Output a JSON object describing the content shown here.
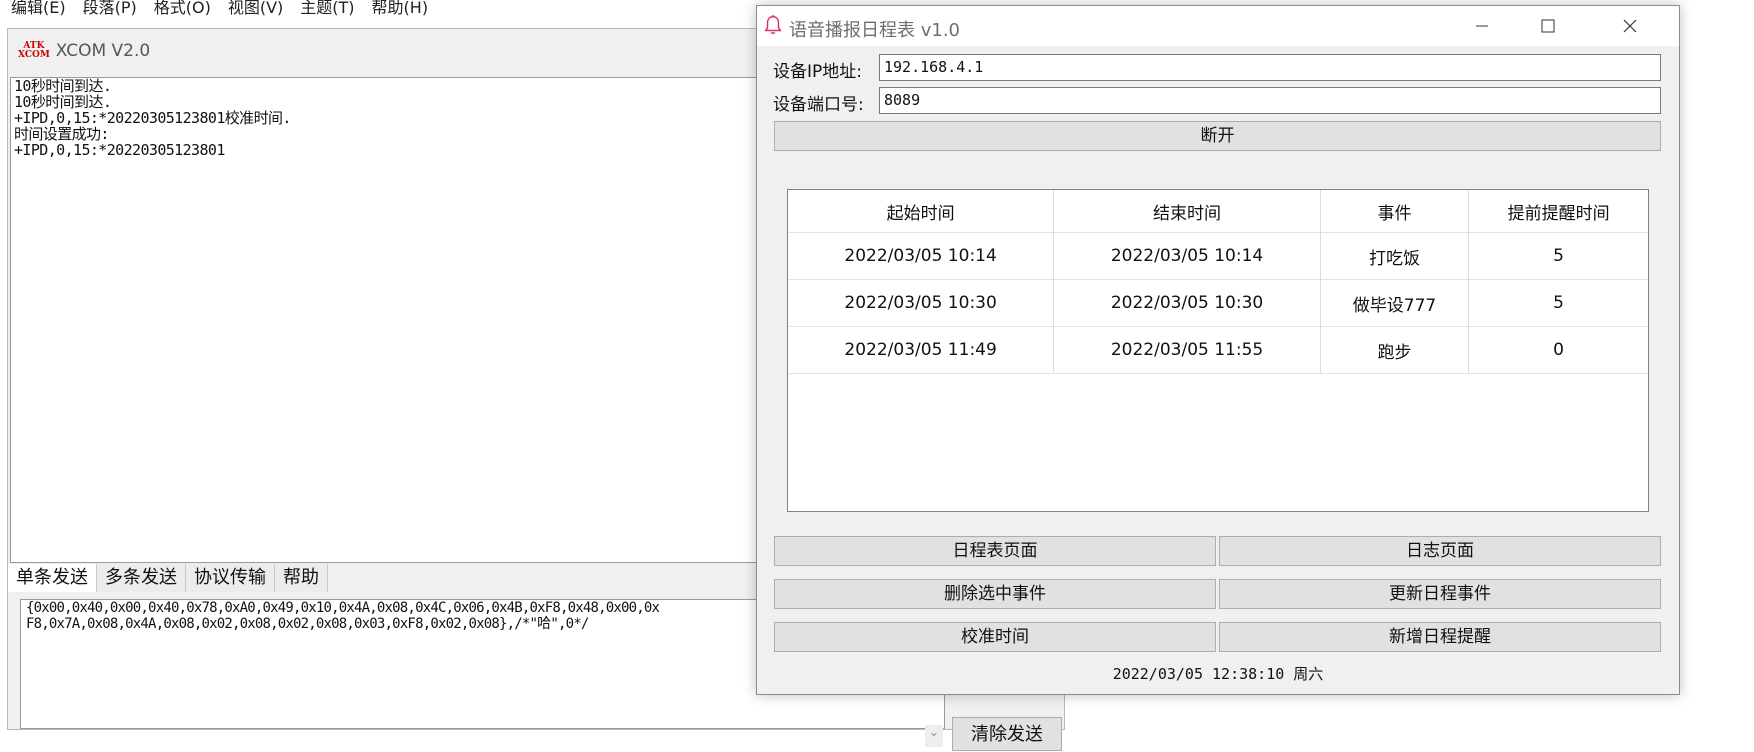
{
  "background_app": {
    "menu": [
      "编辑(E)",
      "段落(P)",
      "格式(O)",
      "视图(V)",
      "主题(T)",
      "帮助(H)"
    ]
  },
  "xcom": {
    "title": "XCOM V2.0",
    "logo_text": "ATK XCOM",
    "receive_lines": [
      "10秒时间到达.",
      "10秒时间到达.",
      "",
      "+IPD,0,15:*20220305123801校准时间.",
      "时间设置成功:",
      "+IPD,0,15:*20220305123801"
    ],
    "tabs": [
      "单条发送",
      "多条发送",
      "协议传输",
      "帮助"
    ],
    "send_lines": [
      "{0x00,0x40,0x00,0x40,0x78,0xA0,0x49,0x10,0x4A,0x08,0x4C,0x06,0x4B,0xF8,0x48,0x00,0x",
      "F8,0x7A,0x08,0x4A,0x08,0x02,0x08,0x02,0x08,0x03,0xF8,0x02,0x08},/*\"哈\",0*/"
    ],
    "clear_send_label": "清除发送"
  },
  "scheduler": {
    "title": "语音播报日程表 v1.0",
    "ip_label": "设备IP地址:",
    "ip_value": "192.168.4.1",
    "port_label": "设备端口号:",
    "port_value": "8089",
    "disconnect_label": "断开",
    "table": {
      "headers": [
        "起始时间",
        "结束时间",
        "事件",
        "提前提醒时间"
      ],
      "rows": [
        [
          "2022/03/05 10:14",
          "2022/03/05 10:14",
          "打吃饭",
          "5"
        ],
        [
          "2022/03/05 10:30",
          "2022/03/05 10:30",
          "做毕设777",
          "5"
        ],
        [
          "2022/03/05 11:49",
          "2022/03/05 11:55",
          "跑步",
          "0"
        ]
      ]
    },
    "buttons": {
      "schedule_page": "日程表页面",
      "log_page": "日志页面",
      "delete_selected": "删除选中事件",
      "update_event": "更新日程事件",
      "calibrate_time": "校准时间",
      "add_reminder": "新增日程提醒"
    },
    "status_time": "2022/03/05 12:38:10 周六",
    "accent_color": "#d6336c"
  }
}
